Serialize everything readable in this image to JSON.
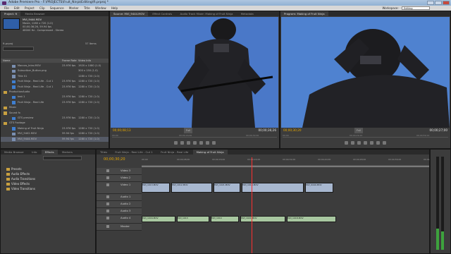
{
  "window": {
    "title": "Adobe Premiere Pro - F:\\PROJECTS\\Fruit_Ninja\\Editing\\ft.prproj *",
    "menu": [
      "File",
      "Edit",
      "Project",
      "Clip",
      "Sequence",
      "Marker",
      "Title",
      "Window",
      "Help"
    ],
    "workspace_label": "Workspace:",
    "workspace_value": "Editing"
  },
  "project": {
    "tabs": [
      "Project: ft",
      "Media Browser"
    ],
    "selected_clip": {
      "name": "MVI_9444.MOV",
      "line1": "Movie, 1280 x 720 (1.0)",
      "line2": "00;00;36;26, 59.94 fps",
      "line3": "48000 Hz - Compressed - Stereo"
    },
    "item_count": "57 Items",
    "bin_label": "ft.prproj",
    "columns": [
      "Name",
      "Frame Rate",
      "Video Info"
    ],
    "rows": [
      {
        "icon": "clip",
        "name": "Maccas_Intro.MOV",
        "fr": "23.976 fps",
        "vi": "1920 x 1080 (1.0)"
      },
      {
        "icon": "clip",
        "name": "Subscriber_Button.png",
        "fr": "",
        "vi": "300 x 150 (1.0)"
      },
      {
        "icon": "clip",
        "name": "Title 01",
        "fr": "",
        "vi": "1280 x 720 (1.0)"
      },
      {
        "icon": "seq",
        "name": "Fruit Ninja - Real Life - Cut 1",
        "fr": "23.976 fps",
        "vi": "1280 x 720 (1.0)"
      },
      {
        "icon": "seq",
        "name": "Fruit Ninja - Real Life - Cut 1",
        "fr": "23.976 fps",
        "vi": "1280 x 720 (1.0)"
      },
      {
        "icon": "bin",
        "name": "ProductionAudio",
        "fr": "",
        "vi": ""
      },
      {
        "icon": "seq",
        "name": "test 1",
        "fr": "23.976 fps",
        "vi": "1280 x 720 (1.0)"
      },
      {
        "icon": "seq",
        "name": "Fruit Ninja - Real Life",
        "fr": "23.976 fps",
        "vi": "1280 x 720 (1.0)"
      },
      {
        "icon": "bin",
        "name": "Music",
        "fr": "",
        "vi": ""
      },
      {
        "icon": "bin",
        "name": "Sound fx",
        "fr": "",
        "vi": ""
      },
      {
        "icon": "seq",
        "name": "GTS preview",
        "fr": "23.976 fps",
        "vi": "1280 x 720 (1.0)"
      },
      {
        "icon": "bin",
        "name": "GTS Footage",
        "fr": "",
        "vi": ""
      },
      {
        "icon": "seq",
        "name": "Making of Fruit Ninja",
        "fr": "23.976 fps",
        "vi": "1280 x 720 (1.0)"
      },
      {
        "icon": "clip",
        "name": "MVI_9402.MOV",
        "fr": "59.94 fps",
        "vi": "1280 x 720 (1.0)"
      },
      {
        "icon": "clip",
        "name": "MVI_9444.MOV",
        "fr": "59.94 fps",
        "vi": "1280 x 720 (1.0)"
      }
    ]
  },
  "source_monitor": {
    "tabs": [
      "Source: MVI_9444.MOV",
      "Effect Controls",
      "Audio Track Mixer: Making of Fruit Ninja",
      "Metadata"
    ],
    "timecode_left": "00;00;08;13",
    "fit": "Full",
    "timecode_right": "00;00;36;26",
    "ruler": [
      "00;00",
      "00;00;16;00",
      "00;00;32;00"
    ]
  },
  "program_monitor": {
    "tabs": [
      "Program: Making of Fruit Ninja"
    ],
    "timecode_left": "00;00;30;20",
    "fit": "Full",
    "timecode_right": "00;00;27;00",
    "ruler": [
      "00;00",
      "00;00;29;15",
      "00;00;59;14"
    ]
  },
  "effects": {
    "tabs": [
      "Media Browser",
      "Info",
      "Effects",
      "Markers"
    ],
    "items": [
      "Presets",
      "Audio Effects",
      "Audio Transitions",
      "Video Effects",
      "Video Transitions"
    ]
  },
  "timeline": {
    "tabs": [
      "Titles",
      "Fruit Ninja - Real Life - Cut 1",
      "Fruit Ninja - Real Life",
      "Making of Fruit Ninja"
    ],
    "timecode": "00;00;30;20",
    "ruler": [
      "00;00",
      "00;00;08;00",
      "00;00;16;00",
      "00;00;24;00",
      "00;00;32;00",
      "00;00;40;00",
      "00;00;48;00",
      "00;00;56;00",
      "00;01;04;00"
    ],
    "tracks": [
      "Video 3",
      "Video 2",
      "Video 1",
      "Audio 1",
      "Audio 2",
      "Audio 3",
      "Audio 4",
      "Master"
    ],
    "v1_clips": [
      "MVI_1013.MOV",
      "MVI_1012.MOV",
      "MVI_1021.MOV",
      "MVI_1018.MOV",
      "MVI_9444.MOV"
    ],
    "a4_clips": [
      "MVI_1016.MOV",
      "MVI_1013",
      "MVI_1014",
      "MVI_1021.MOV",
      "MVI_1018.MOV"
    ]
  },
  "colors": {
    "accent_timecode": "#e6a800",
    "video_bg": "#4a78c8",
    "playhead": "#ff3030"
  }
}
